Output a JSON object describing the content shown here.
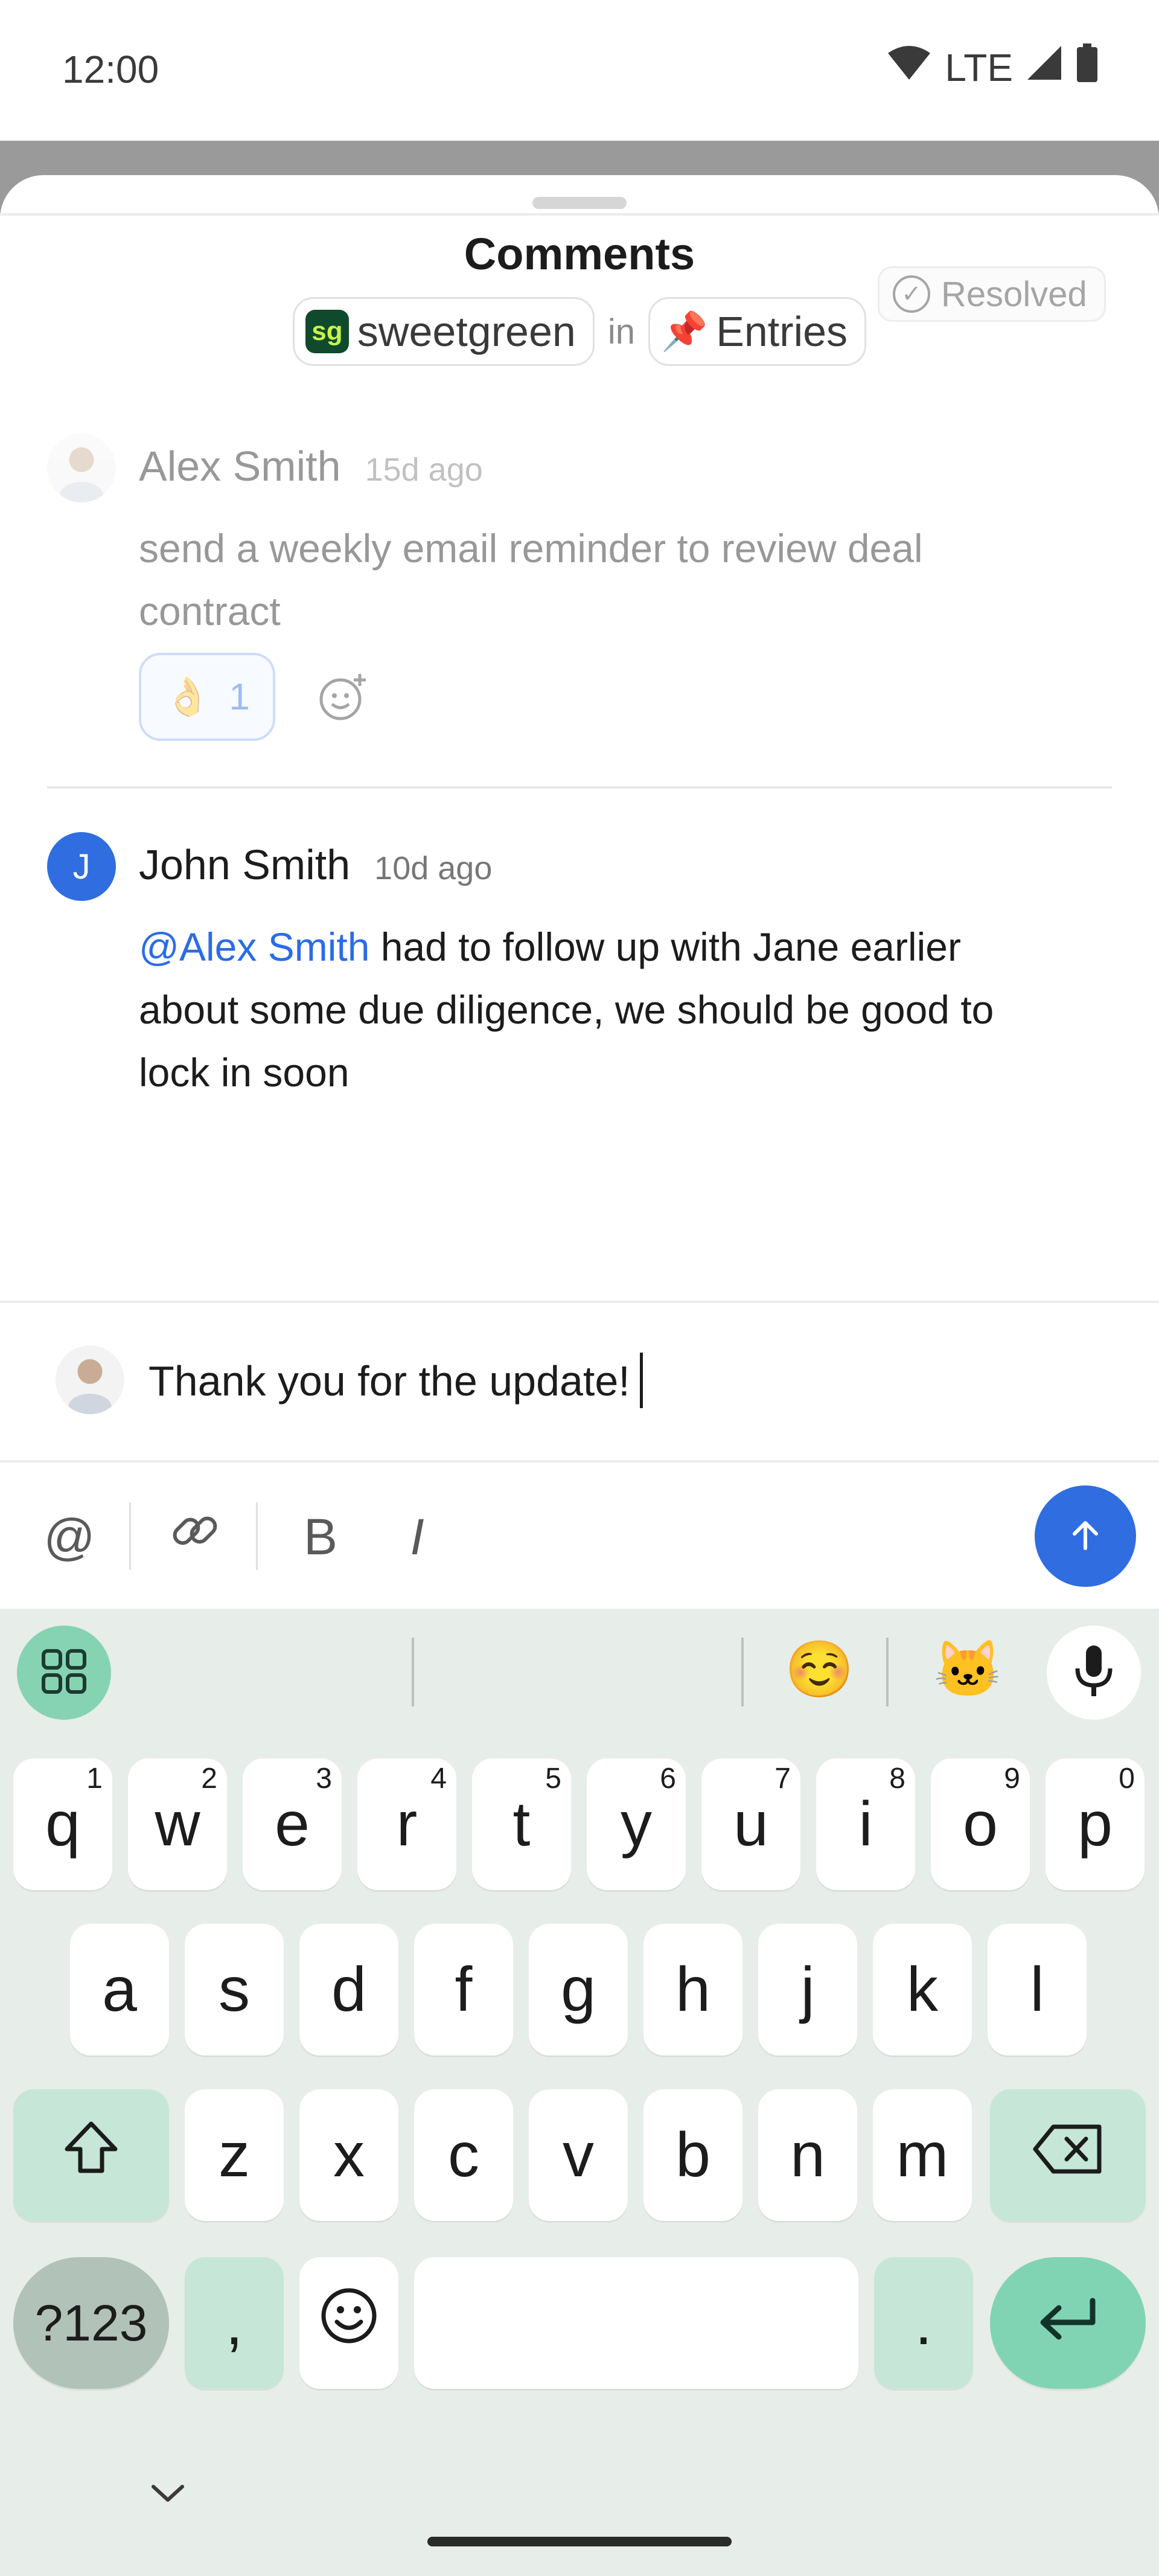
{
  "status_bar": {
    "time": "12:00",
    "network": "LTE",
    "icons": [
      "wifi-icon",
      "cell-signal-icon",
      "battery-icon"
    ]
  },
  "sheet": {
    "title": "Comments",
    "breadcrumb": {
      "company_logo": "sg",
      "company": "sweetgreen",
      "separator": "in",
      "list_icon": "📌",
      "list": "Entries"
    }
  },
  "comments": [
    {
      "author": "Alex Smith",
      "time": "15d ago",
      "text": "send a weekly email reminder to review deal contract",
      "text_line1": "send a weekly email reminder to review deal",
      "text_line2": "contract",
      "status_label": "Resolved",
      "reaction": {
        "emoji": "👌",
        "count": "1"
      },
      "resolved": true
    },
    {
      "author": "John Smith",
      "avatar_letter": "J",
      "time": "10d ago",
      "mention": "@Alex Smith",
      "text_line1": " had to follow up with Jane earlier",
      "text_line2": "about some due diligence, we should be good to",
      "text_line3": "lock in soon"
    }
  ],
  "composer": {
    "value": "Thank you for the update!"
  },
  "toolbar": {
    "mention": "@",
    "bold": "B",
    "italic": "I"
  },
  "keyboard": {
    "suggestion_emojis": [
      "☺️",
      "🐱"
    ],
    "row1": [
      {
        "k": "q",
        "h": "1"
      },
      {
        "k": "w",
        "h": "2"
      },
      {
        "k": "e",
        "h": "3"
      },
      {
        "k": "r",
        "h": "4"
      },
      {
        "k": "t",
        "h": "5"
      },
      {
        "k": "y",
        "h": "6"
      },
      {
        "k": "u",
        "h": "7"
      },
      {
        "k": "i",
        "h": "8"
      },
      {
        "k": "o",
        "h": "9"
      },
      {
        "k": "p",
        "h": "0"
      }
    ],
    "row2": [
      "a",
      "s",
      "d",
      "f",
      "g",
      "h",
      "j",
      "k",
      "l"
    ],
    "row3": [
      "z",
      "x",
      "c",
      "v",
      "b",
      "n",
      "m"
    ],
    "symbols_label": "?123",
    "comma": ",",
    "period": "."
  },
  "colors": {
    "accent": "#2f6de0",
    "mention": "#2b6ce6",
    "keyboard_bg": "#e7ede9",
    "action_key": "#80d4b4"
  }
}
